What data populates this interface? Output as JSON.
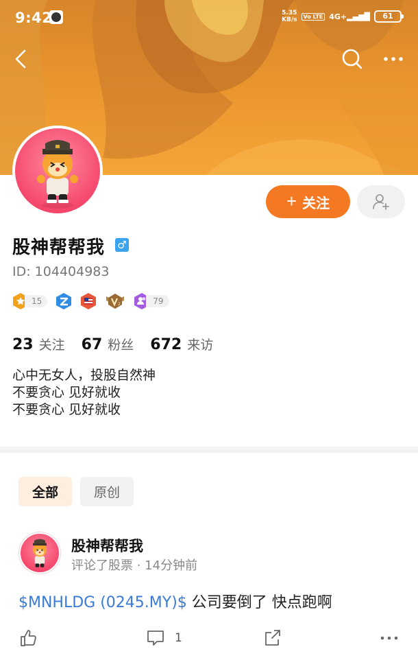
{
  "status_bar": {
    "time": "9:42",
    "net_speed_value": "5.35",
    "net_speed_unit": "KB/s",
    "volte": "Vo LTE",
    "signal": "4G+",
    "battery": "61"
  },
  "nav": {
    "back_icon": "chevron-left-icon",
    "search_icon": "search-icon",
    "more_icon": "more-horizontal-icon"
  },
  "profile": {
    "name": "股神帮帮我",
    "gender_symbol": "♂",
    "id_text": "ID: 104404983",
    "follow_label": "关注",
    "badges": [
      {
        "icon": "star-hexagon-badge-icon",
        "color": "#f2a21c",
        "count": "15"
      },
      {
        "icon": "z-shield-badge-icon",
        "color": "#2f8de4",
        "count": ""
      },
      {
        "icon": "flag-badge-icon",
        "color": "#e8573a",
        "count": ""
      },
      {
        "icon": "v2-wings-badge-icon",
        "color": "#9a6a34",
        "count": ""
      },
      {
        "icon": "users-hexagon-badge-icon",
        "color": "#a45de0",
        "count": "79"
      }
    ],
    "stats": [
      {
        "value": "23",
        "label": "关注"
      },
      {
        "value": "67",
        "label": "粉丝"
      },
      {
        "value": "672",
        "label": "来访"
      }
    ],
    "bio": [
      "心中无女人，投股自然神",
      "不要贪心 见好就收",
      "不要贪心 见好就收"
    ]
  },
  "tabs": [
    {
      "label": "全部",
      "active": true
    },
    {
      "label": "原创",
      "active": false
    }
  ],
  "post": {
    "author": "股神帮帮我",
    "meta": "评论了股票 · 14分钟前",
    "ticker": "$MNHLDG (0245.MY)$",
    "text": " 公司要倒了 快点跑啊",
    "comment_count": "1"
  },
  "colors": {
    "accent": "#f57823",
    "link": "#3a7bd5",
    "avatar_bg": "#f5486c"
  }
}
